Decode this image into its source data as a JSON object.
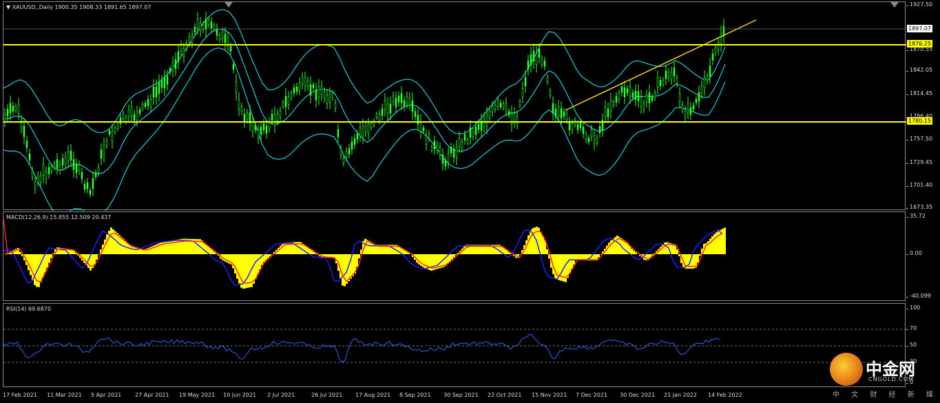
{
  "main": {
    "label": "XAUUSD,,Daily  1900.35 1908.33 1891.65 1897.07",
    "price_ticks": [
      "1927.50",
      "1870.55",
      "1842.05",
      "1814.45",
      "1786.40",
      "1757.50",
      "1729.45",
      "1701.40",
      "1673.35"
    ],
    "tags": {
      "current": "1897.07",
      "resistance": "1876.25",
      "support": "1780.15"
    },
    "colors": {
      "candles": "#33ff33",
      "bands": "#20c0c8",
      "hline": "#ffff00",
      "trendline": "#ffd700"
    }
  },
  "macd": {
    "label": "MACD(12,26,9) 15.855 12.509 20.437",
    "ticks": [
      "35.72",
      "0.00",
      "-40.099"
    ],
    "colors": {
      "histogram": "#ffff00",
      "macd_line": "#2020ff",
      "signal_line": "#ff2020"
    }
  },
  "rsi": {
    "label": "RSI(14) 69.6870",
    "ticks": [
      "100",
      "70",
      "50",
      "30",
      "0"
    ],
    "colors": {
      "line": "#3060ff"
    }
  },
  "dates": [
    "17 Feb 2021",
    "11 Mar 2021",
    "5 Apr 2021",
    "27 Apr 2021",
    "19 May 2021",
    "10 Jun 2021",
    "2 Jul 2021",
    "26 Jul 2021",
    "17 Aug 2021",
    "8 Sep 2021",
    "30 Sep 2021",
    "22 Oct 2021",
    "15 Nov 2021",
    "7 Dec 2021",
    "30 Dec 2021",
    "21 Jan 2022",
    "14 Feb 2022"
  ],
  "logo": {
    "name": "中金网",
    "domain": "CNGOLD.COM",
    "tagline": "中 文 财 经 新 媒 体",
    "icon": "gold-circle-logo-icon"
  }
}
